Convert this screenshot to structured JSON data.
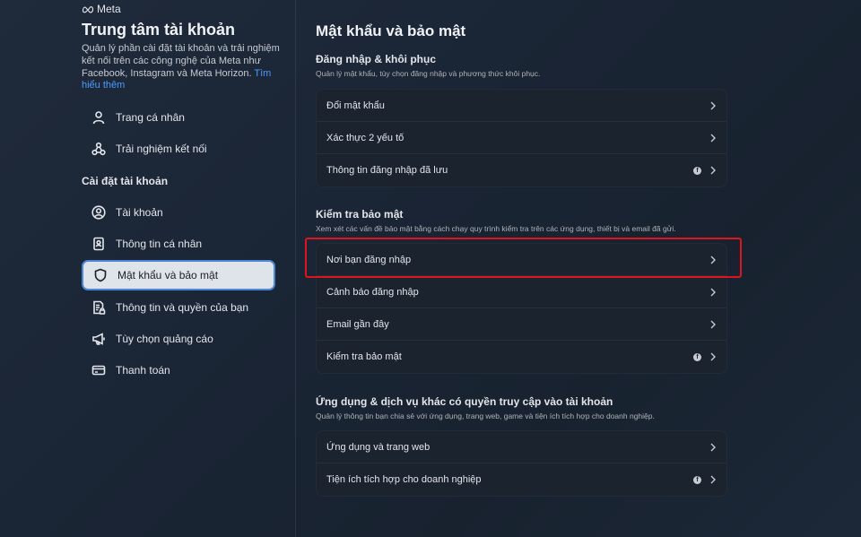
{
  "brand": {
    "name": "Meta"
  },
  "sidebar": {
    "title": "Trung tâm tài khoản",
    "desc": "Quản lý phần cài đặt tài khoản và trải nghiệm kết nối trên các công nghệ của Meta như Facebook, Instagram và Meta Horizon. ",
    "learn_more": "Tìm hiểu thêm",
    "top_items": [
      {
        "label": "Trang cá nhân",
        "icon": "person-icon"
      },
      {
        "label": "Trải nghiệm kết nối",
        "icon": "connected-icon"
      }
    ],
    "section_title": "Cài đặt tài khoản",
    "settings_items": [
      {
        "label": "Tài khoản",
        "icon": "account-circle-icon"
      },
      {
        "label": "Thông tin cá nhân",
        "icon": "id-card-icon"
      },
      {
        "label": "Mật khẩu và bảo mật",
        "icon": "shield-icon",
        "active": true
      },
      {
        "label": "Thông tin và quyền của bạn",
        "icon": "document-lock-icon"
      },
      {
        "label": "Tùy chọn quảng cáo",
        "icon": "megaphone-icon"
      },
      {
        "label": "Thanh toán",
        "icon": "credit-card-icon"
      }
    ]
  },
  "main": {
    "title": "Mật khẩu và bảo mật",
    "sections": [
      {
        "title": "Đăng nhập & khôi phục",
        "desc": "Quản lý mật khẩu, tùy chọn đăng nhập và phương thức khôi phục.",
        "rows": [
          {
            "label": "Đổi mật khẩu",
            "fb": false
          },
          {
            "label": "Xác thực 2 yếu tố",
            "fb": false
          },
          {
            "label": "Thông tin đăng nhập đã lưu",
            "fb": true
          }
        ]
      },
      {
        "title": "Kiểm tra bảo mật",
        "desc": "Xem xét các vấn đề bảo mật bằng cách chạy quy trình kiểm tra trên các ứng dụng, thiết bị và email đã gửi.",
        "rows": [
          {
            "label": "Nơi bạn đăng nhập",
            "fb": false
          },
          {
            "label": "Cảnh báo đăng nhập",
            "fb": false
          },
          {
            "label": "Email gần đây",
            "fb": false
          },
          {
            "label": "Kiểm tra bảo mật",
            "fb": true
          }
        ]
      },
      {
        "title": "Ứng dụng & dịch vụ khác có quyền truy cập vào tài khoản",
        "desc": "Quản lý thông tin bạn chia sẻ với ứng dụng, trang web, game và tiện ích tích hợp cho doanh nghiệp.",
        "rows": [
          {
            "label": "Ứng dụng và trang web",
            "fb": false
          },
          {
            "label": "Tiện ích tích hợp cho doanh nghiệp",
            "fb": true
          }
        ]
      }
    ]
  },
  "colors": {
    "accent": "#4c86d6",
    "highlight": "#e0141f",
    "link": "#4b9bff"
  }
}
